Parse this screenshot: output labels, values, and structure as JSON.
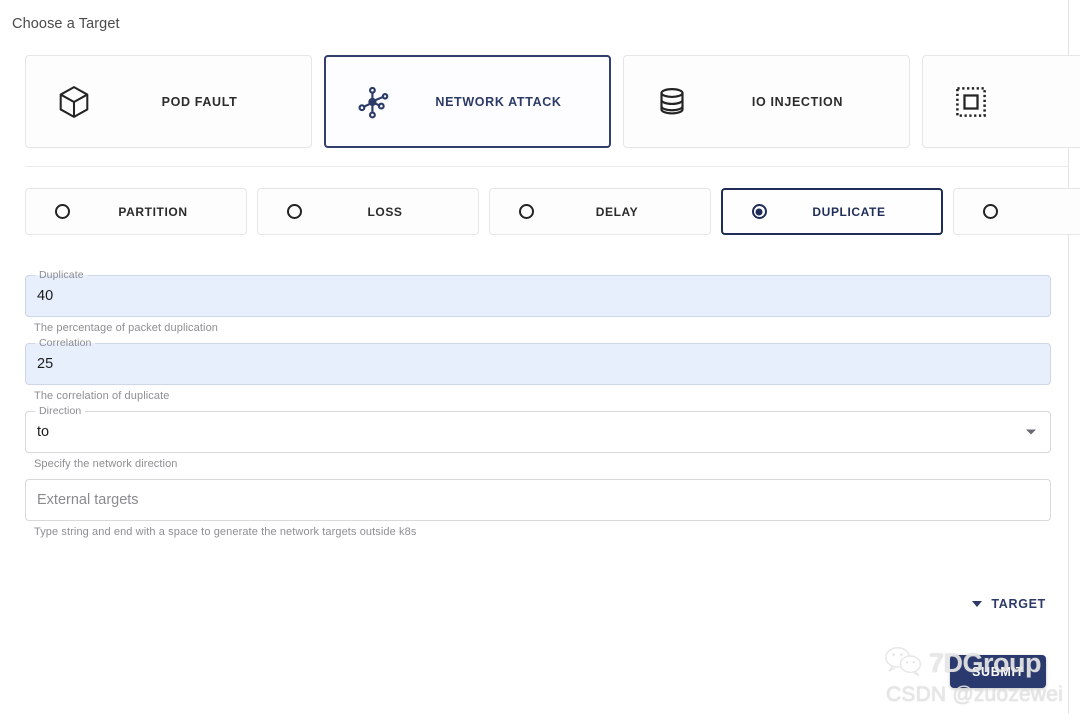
{
  "heading": "Choose a Target",
  "targets": [
    {
      "label": "POD FAULT",
      "icon": "cube-icon",
      "selected": false
    },
    {
      "label": "NETWORK ATTACK",
      "icon": "network-nodes-icon",
      "selected": true
    },
    {
      "label": "IO INJECTION",
      "icon": "database-icon",
      "selected": false
    },
    {
      "label": "",
      "icon": "dashed-square-icon",
      "selected": false
    }
  ],
  "actions": [
    {
      "label": "PARTITION",
      "selected": false
    },
    {
      "label": "LOSS",
      "selected": false
    },
    {
      "label": "DELAY",
      "selected": false
    },
    {
      "label": "DUPLICATE",
      "selected": true
    },
    {
      "label": "",
      "selected": false
    }
  ],
  "fields": {
    "duplicate": {
      "legend": "Duplicate",
      "value": "40",
      "helper": "The percentage of packet duplication"
    },
    "correlation": {
      "legend": "Correlation",
      "value": "25",
      "helper": "The correlation of duplicate"
    },
    "direction": {
      "legend": "Direction",
      "value": "to",
      "helper": "Specify the network direction"
    },
    "external_targets": {
      "placeholder": "External targets",
      "value": "",
      "helper": "Type string and end with a space to generate the network targets outside k8s"
    }
  },
  "target_expander": {
    "label": "TARGET",
    "icon": "chevron-down-icon"
  },
  "submit": {
    "label": "SUBMIT"
  },
  "watermark": {
    "brand": "7DGroup",
    "credit": "CSDN @zuozewei",
    "icon": "wechat-icon"
  },
  "colors": {
    "accent_navy": "#2b3a66",
    "selected_border": "#1f2d57",
    "submit_bg": "#2b3a6e",
    "autofill_bg": "#e8effc",
    "field_border": "#d8d8dd",
    "card_border": "#e6e6e9"
  }
}
